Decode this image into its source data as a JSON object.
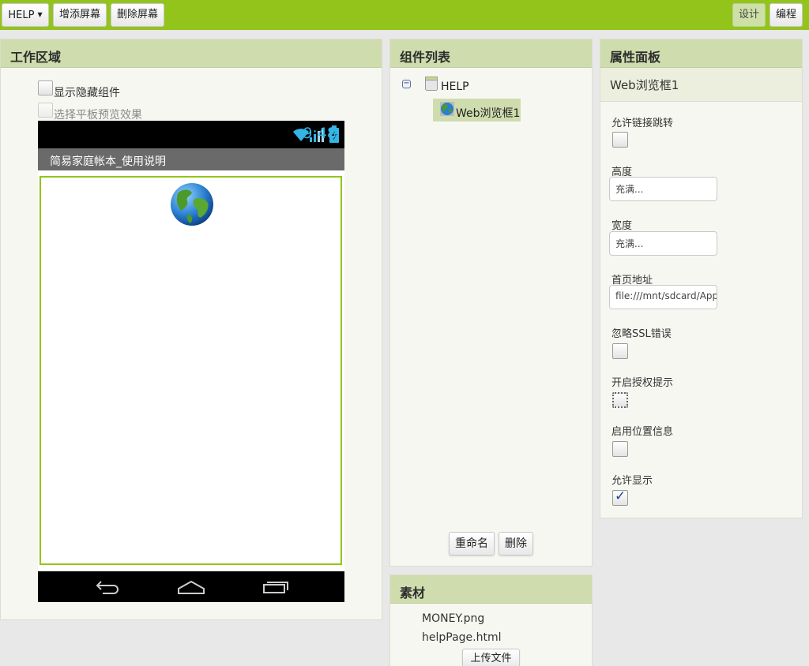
{
  "toolbar": {
    "screen_select": "HELP",
    "add_screen": "增添屏幕",
    "remove_screen": "删除屏幕",
    "designer": "设计",
    "blocks": "编程"
  },
  "viewer": {
    "title": "工作区域",
    "show_hidden_label": "显示隐藏组件",
    "tablet_preview_label": "选择平板预览效果",
    "phone": {
      "clock": "9:48",
      "app_title": "简易家庭帐本_使用说明"
    }
  },
  "components": {
    "title": "组件列表",
    "tree": [
      {
        "label": "HELP"
      },
      {
        "label": "Web浏览框1",
        "selected": true
      }
    ],
    "rename": "重命名",
    "delete": "删除"
  },
  "assets": {
    "title": "素材",
    "files": [
      "MONEY.png",
      "helpPage.html"
    ],
    "upload": "上传文件"
  },
  "properties": {
    "title": "属性面板",
    "component_name": "Web浏览框1",
    "follow_links": {
      "label": "允许链接跳转",
      "checked": false
    },
    "height": {
      "label": "高度",
      "value": "充满..."
    },
    "width": {
      "label": "宽度",
      "value": "充满..."
    },
    "home_url": {
      "label": "首页地址",
      "value": "file:///mnt/sdcard/AppInventor/assets/helpPage.html"
    },
    "ignore_ssl": {
      "label": "忽略SSL错误",
      "checked": false
    },
    "prompt_permission": {
      "label": "开启授权提示",
      "checked": false
    },
    "use_location": {
      "label": "启用位置信息",
      "checked": false
    },
    "visible": {
      "label": "允许显示",
      "checked": true
    }
  },
  "colors": {
    "accent": "#93c41b",
    "panel_header": "#cfdcae",
    "clock": "#33b5e5"
  }
}
